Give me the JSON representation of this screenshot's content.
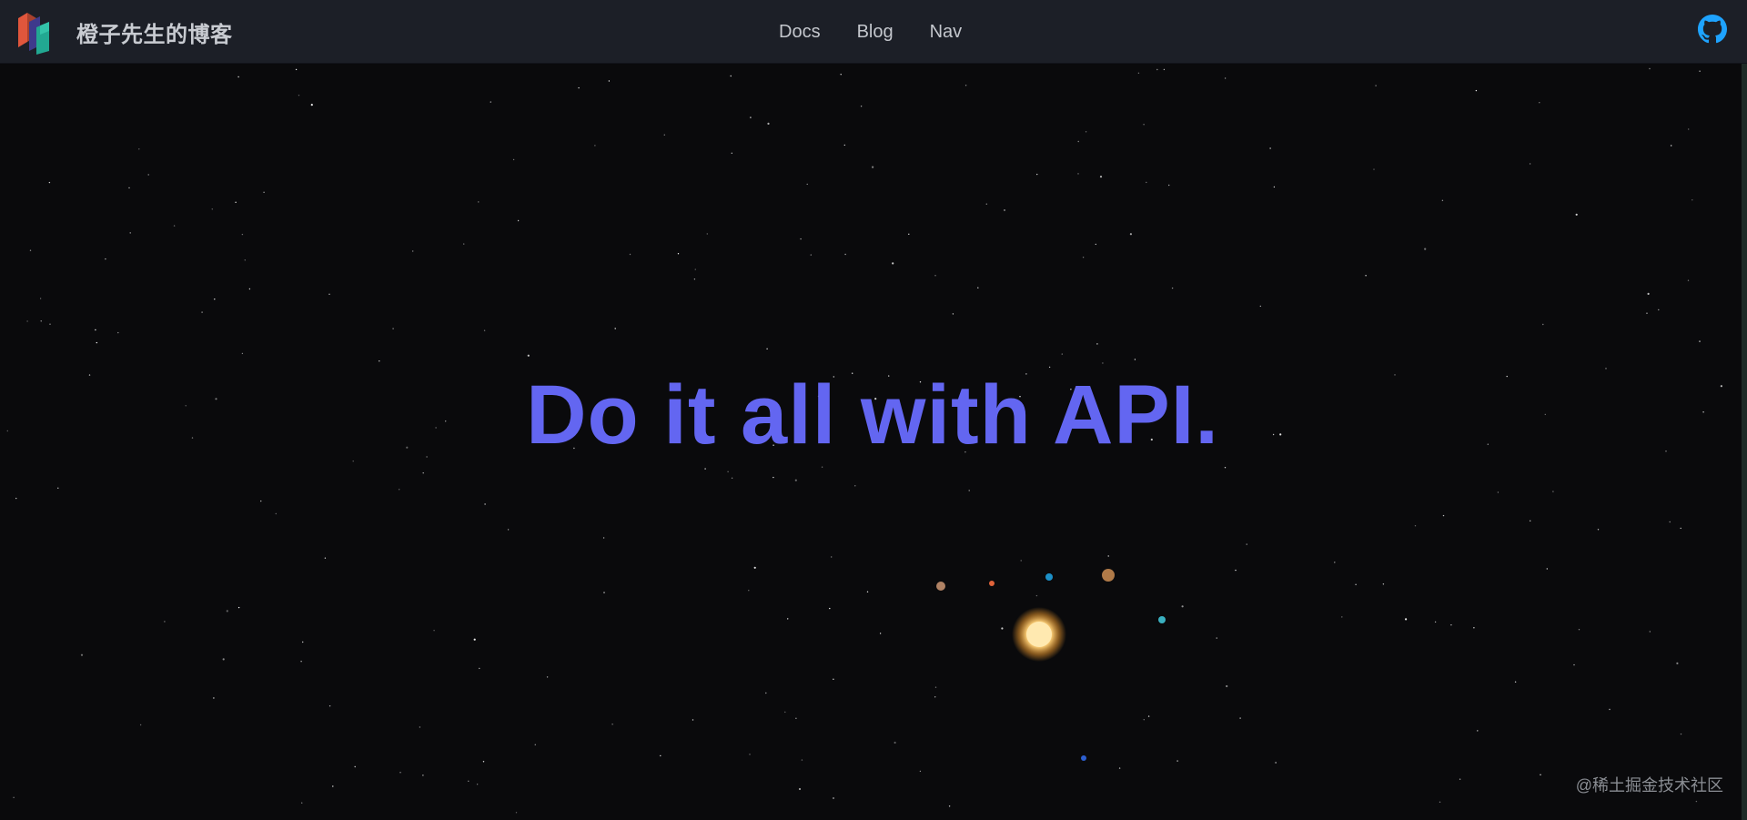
{
  "header": {
    "site_title": "橙子先生的博客",
    "nav": [
      {
        "label": "Docs"
      },
      {
        "label": "Blog"
      },
      {
        "label": "Nav"
      }
    ],
    "github_icon": "github-icon"
  },
  "hero": {
    "headline": "Do it all with API."
  },
  "footer": {
    "watermark": "@稀土掘金技术社区"
  },
  "colors": {
    "navbar_bg": "#1c1f27",
    "page_bg": "#0a0a0c",
    "headline": "#6366f1",
    "github": "#1ea3ff",
    "sun": "#ffd98a"
  }
}
